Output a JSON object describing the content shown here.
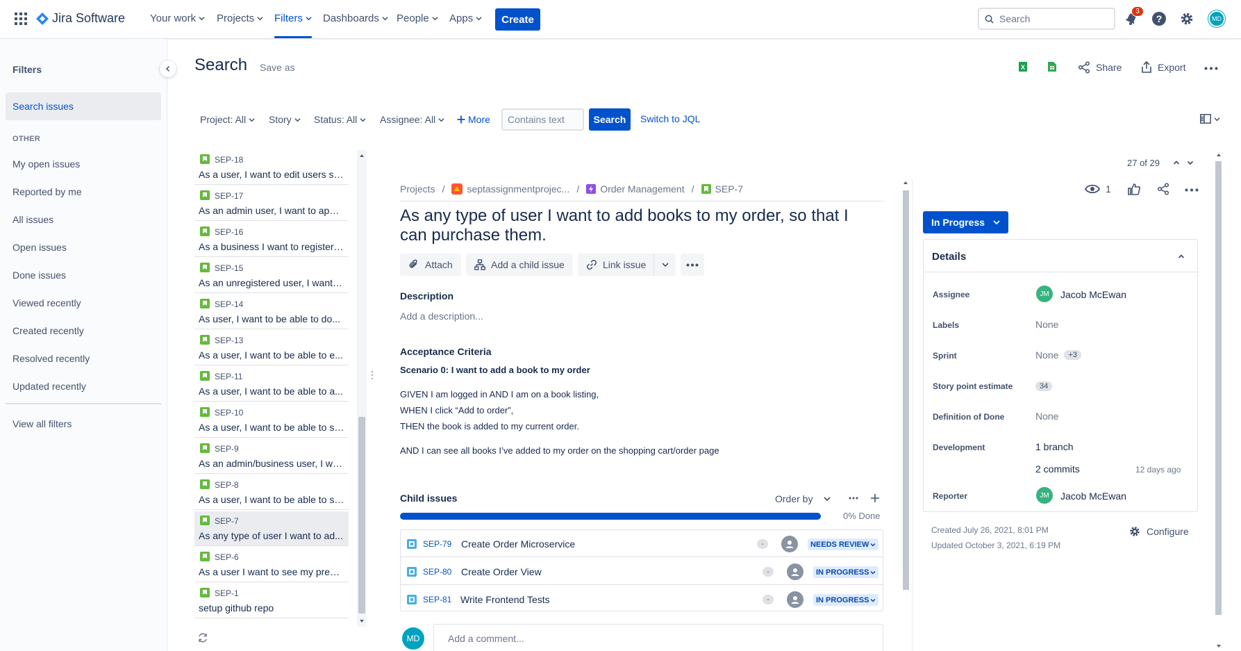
{
  "nav": {
    "product": "Jira Software",
    "items": [
      {
        "label": "Your work"
      },
      {
        "label": "Projects"
      },
      {
        "label": "Filters"
      },
      {
        "label": "Dashboards"
      },
      {
        "label": "People"
      },
      {
        "label": "Apps"
      }
    ],
    "create_label": "Create",
    "search_placeholder": "Search",
    "notification_count": "3",
    "user_initials": "MD"
  },
  "sidebar": {
    "title": "Filters",
    "active_item": "Search issues",
    "section_label": "OTHER",
    "links": [
      "My open issues",
      "Reported by me",
      "All issues",
      "Open issues",
      "Done issues",
      "Viewed recently",
      "Created recently",
      "Resolved recently",
      "Updated recently"
    ],
    "view_all": "View all filters"
  },
  "header": {
    "title": "Search",
    "save_as": "Save as",
    "share": "Share",
    "export": "Export"
  },
  "filters": {
    "project": "Project: All",
    "type": "Story",
    "status": "Status: All",
    "assignee": "Assignee: All",
    "more": "More",
    "text_placeholder": "Contains text",
    "search_button": "Search",
    "switch_jql": "Switch to JQL"
  },
  "issues": [
    {
      "key": "SEP-18",
      "summary": "As a user, I want to edit users so..."
    },
    {
      "key": "SEP-17",
      "summary": "As an admin user, I want to appr..."
    },
    {
      "key": "SEP-16",
      "summary": "As a business I want to register ..."
    },
    {
      "key": "SEP-15",
      "summary": "As an unregistered user, I want i..."
    },
    {
      "key": "SEP-14",
      "summary": "As user, I want to be able to do..."
    },
    {
      "key": "SEP-13",
      "summary": "As a user, I want to be able to e..."
    },
    {
      "key": "SEP-11",
      "summary": "As a user, I want to be able to a..."
    },
    {
      "key": "SEP-10",
      "summary": "As a user, I want to be able to se..."
    },
    {
      "key": "SEP-9",
      "summary": "As an admin/business user, I wa..."
    },
    {
      "key": "SEP-8",
      "summary": "As a user, I want to be able to se..."
    },
    {
      "key": "SEP-7",
      "summary": "As any type of user I want to ad..."
    },
    {
      "key": "SEP-6",
      "summary": "As a user I want to see my previ..."
    },
    {
      "key": "SEP-1",
      "summary": "setup github repo"
    }
  ],
  "detail": {
    "counter": "27 of 29",
    "breadcrumb": {
      "projects": "Projects",
      "project": "septassignmentprojec...",
      "epic": "Order Management",
      "key": "SEP-7"
    },
    "title": "As any type of user I want to add books to my order, so that I can purchase them.",
    "toolbar": {
      "attach": "Attach",
      "add_child": "Add a child issue",
      "link_issue": "Link issue"
    },
    "watchers": "1",
    "description_label": "Description",
    "description_placeholder": "Add a description...",
    "acceptance_label": "Acceptance Criteria",
    "scenario": "Scenario 0: I want to add a book to my order",
    "criteria": [
      "GIVEN I am logged in AND I am on a book listing,",
      "WHEN I click “Add to order”,",
      "THEN the book is added to my current order."
    ],
    "criteria_extra": "AND I can see all books I’ve added to my order on the shopping cart/order page",
    "child_issues_label": "Child issues",
    "order_by": "Order by",
    "progress_label": "0% Done",
    "progress_done_fraction": 0,
    "children": [
      {
        "key": "SEP-79",
        "summary": "Create Order Microservice",
        "priority": "-",
        "status": "NEEDS REVIEW"
      },
      {
        "key": "SEP-80",
        "summary": "Create Order View",
        "priority": "-",
        "status": "IN PROGRESS"
      },
      {
        "key": "SEP-81",
        "summary": "Write Frontend Tests",
        "priority": "-",
        "status": "IN PROGRESS"
      }
    ],
    "comment_placeholder": "Add a comment...",
    "comment_avatar": "MD"
  },
  "side": {
    "status": "In Progress",
    "details_title": "Details",
    "assignee_label": "Assignee",
    "assignee_initials": "JM",
    "assignee": "Jacob McEwan",
    "labels_label": "Labels",
    "labels": "None",
    "sprint_label": "Sprint",
    "sprint": "None",
    "sprint_extra": "+3",
    "sp_label": "Story point estimate",
    "sp": "34",
    "dod_label": "Definition of Done",
    "dod": "None",
    "dev_label": "Development",
    "branch": "1 branch",
    "commits": "2 commits",
    "commits_time": "12 days ago",
    "reporter_label": "Reporter",
    "reporter_initials": "JM",
    "reporter": "Jacob McEwan",
    "created": "Created July 26, 2021, 8:01 PM",
    "updated": "Updated October 3, 2021, 6:19 PM",
    "configure": "Configure"
  },
  "colors": {
    "brand": "#0052CC",
    "story_green": "#63BA3C",
    "subtask_blue": "#4BADE8",
    "badge_red": "#DE350B"
  }
}
